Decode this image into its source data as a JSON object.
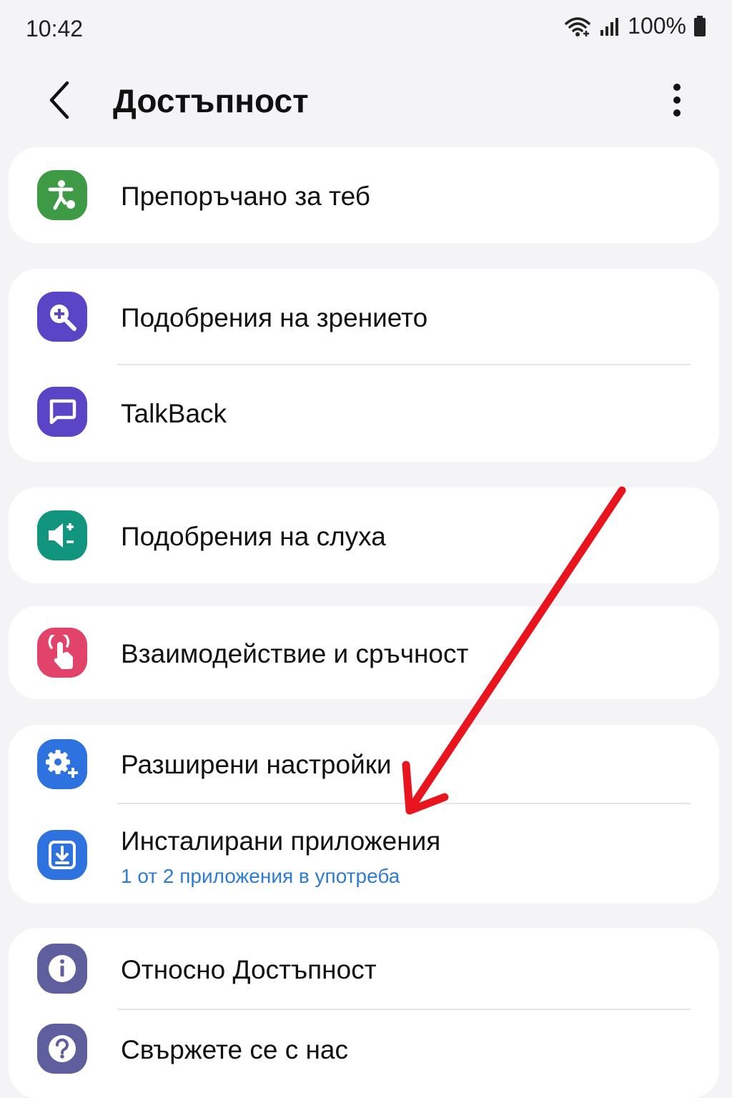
{
  "status": {
    "time": "10:42",
    "battery": "100%"
  },
  "header": {
    "title": "Достъпност"
  },
  "cards": [
    {
      "items": [
        {
          "label": "Препоръчано за теб",
          "icon": "accessibility-icon",
          "color": "#3f9a45"
        }
      ]
    },
    {
      "items": [
        {
          "label": "Подобрения на зрението",
          "icon": "magnifier-plus-icon",
          "color": "#5b45c7"
        },
        {
          "label": "TalkBack",
          "icon": "speech-bubble-icon",
          "color": "#5b45c7"
        }
      ]
    },
    {
      "items": [
        {
          "label": "Подобрения на слуха",
          "icon": "speaker-plus-minus-icon",
          "color": "#12957f"
        }
      ]
    },
    {
      "items": [
        {
          "label": "Взаимодействие и сръчност",
          "icon": "hand-tap-icon",
          "color": "#e2436a"
        }
      ]
    },
    {
      "items": [
        {
          "label": "Разширени настройки",
          "icon": "gear-plus-icon",
          "color": "#2e72e0"
        },
        {
          "label": "Инсталирани приложения",
          "sub": "1 от 2 приложения в употреба",
          "icon": "download-icon",
          "color": "#2e72e0"
        }
      ]
    },
    {
      "items": [
        {
          "label": "Относно Достъпност",
          "icon": "info-icon",
          "color": "#5f5f9e"
        },
        {
          "label": "Свържете се с нас",
          "icon": "question-icon",
          "color": "#5f5f9e"
        }
      ]
    }
  ],
  "annotation": {
    "color": "#e8141e"
  }
}
